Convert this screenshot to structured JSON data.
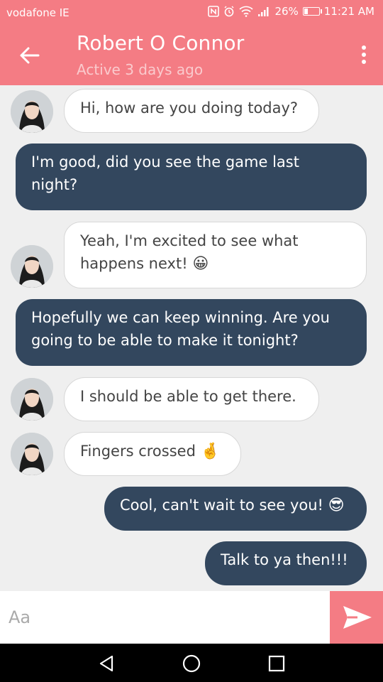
{
  "status": {
    "carrier": "vodafone IE",
    "battery": "26%",
    "time": "11:21 AM"
  },
  "header": {
    "name": "Robert O Connor",
    "presence": "Active 3 days ago"
  },
  "messages": [
    {
      "from": "them",
      "text": "Hi, how are you doing today?"
    },
    {
      "from": "me",
      "line1": "I'm good, did you see the game last",
      "line2": "night?"
    },
    {
      "from": "them",
      "line1": "Yeah, I'm excited to see what",
      "line2": "happens next!",
      "emoji": "😀"
    },
    {
      "from": "me",
      "line1": "Hopefully we can keep winning. Are you",
      "line2": "going to be able to make it tonight?"
    },
    {
      "from": "them",
      "text": "I should be able to get there."
    },
    {
      "from": "them",
      "text": "Fingers crossed",
      "emoji": "🤞"
    },
    {
      "from": "me",
      "text": "Cool, can't wait to see you!",
      "emoji": "😎"
    },
    {
      "from": "me",
      "text": "Talk to ya then!!!"
    }
  ],
  "composer": {
    "placeholder": "Aa"
  },
  "colors": {
    "accent": "#f47c84",
    "outgoing_bubble": "#33475e",
    "incoming_bubble": "#ffffff",
    "background": "#efefef"
  }
}
